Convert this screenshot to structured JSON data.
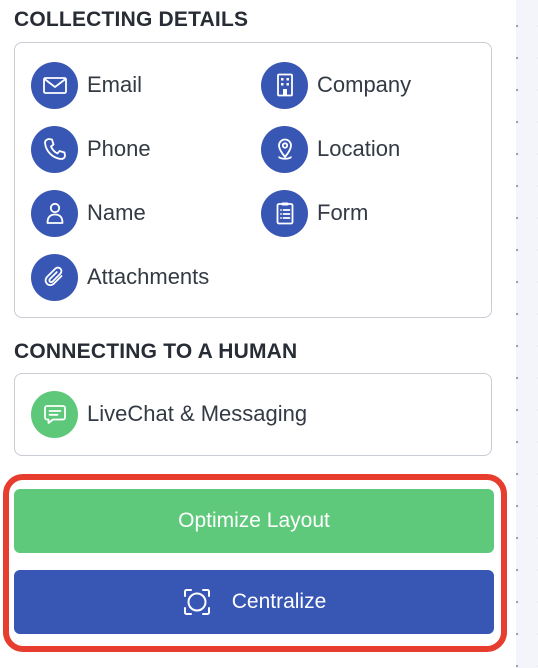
{
  "sections": {
    "collecting": {
      "title": "COLLECTING DETAILS",
      "items": [
        {
          "label": "Email",
          "icon": "envelope-icon"
        },
        {
          "label": "Company",
          "icon": "building-icon"
        },
        {
          "label": "Phone",
          "icon": "phone-icon"
        },
        {
          "label": "Location",
          "icon": "map-pin-icon"
        },
        {
          "label": "Name",
          "icon": "person-icon"
        },
        {
          "label": "Form",
          "icon": "clipboard-list-icon"
        },
        {
          "label": "Attachments",
          "icon": "paperclip-icon"
        }
      ]
    },
    "human": {
      "title": "CONNECTING TO A HUMAN",
      "items": [
        {
          "label": "LiveChat & Messaging",
          "icon": "chat-bubble-icon"
        }
      ]
    }
  },
  "actions": {
    "optimize_label": "Optimize Layout",
    "centralize_label": "Centralize",
    "centralize_icon": "focus-frame-icon"
  },
  "colors": {
    "primary_blue": "#3856b4",
    "success_green": "#5ec97b",
    "highlight_red": "#e63d2f",
    "text": "#333a44",
    "border": "#c8ccd3"
  }
}
